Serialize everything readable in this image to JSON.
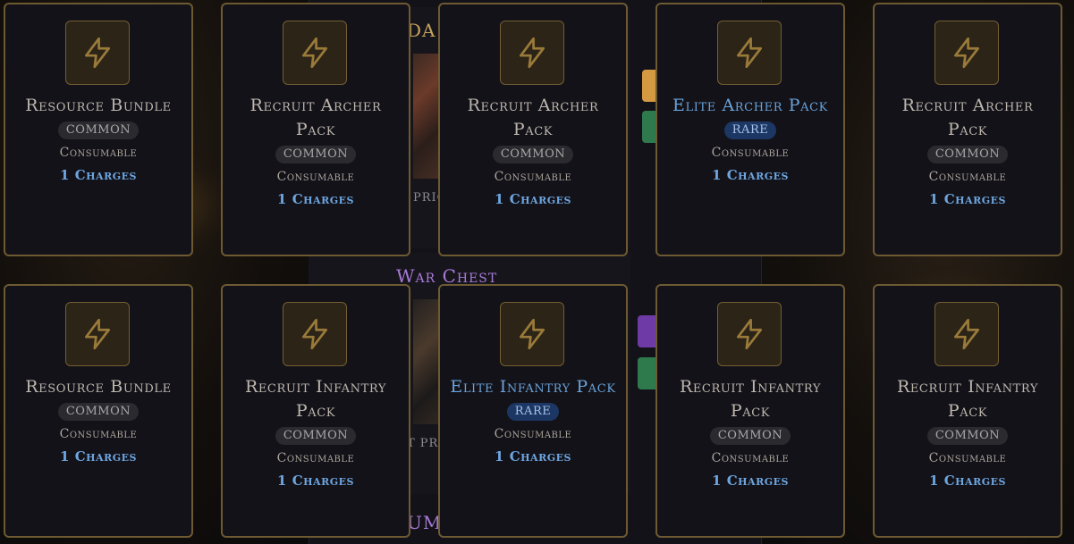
{
  "background_sections": [
    {
      "title": "DA",
      "subtitle": "PRIC",
      "title_color": "#c6a35c"
    },
    {
      "title": "War Chest",
      "subtitle": "T PRI",
      "title_color": "#a77ad8"
    },
    {
      "title": "UMA",
      "subtitle": "",
      "title_color": "#a77ad8"
    }
  ],
  "side_button_colors": [
    "#d49a42",
    "#2f7a4d",
    "#6e3aa6",
    "#2f7a4d"
  ],
  "icon_name": "lightning-bolt-icon",
  "colors": {
    "card_border": "#6d5a32",
    "icon_stroke": "#9a7a3a",
    "rare_name": "#6aa2d9",
    "charges": "#6ea6e0"
  },
  "cards": [
    {
      "name": "Resource Bundle",
      "rarity": "common",
      "rarity_label": "COMMON",
      "type": "Consumable",
      "charges": "1 Charges"
    },
    {
      "name": "Recruit Archer Pack",
      "rarity": "common",
      "rarity_label": "COMMON",
      "type": "Consumable",
      "charges": "1 Charges"
    },
    {
      "name": "Recruit Archer Pack",
      "rarity": "common",
      "rarity_label": "COMMON",
      "type": "Consumable",
      "charges": "1 Charges"
    },
    {
      "name": "Elite Archer Pack",
      "rarity": "rare",
      "rarity_label": "RARE",
      "type": "Consumable",
      "charges": "1 Charges"
    },
    {
      "name": "Recruit Archer Pack",
      "rarity": "common",
      "rarity_label": "COMMON",
      "type": "Consumable",
      "charges": "1 Charges"
    },
    {
      "name": "Resource Bundle",
      "rarity": "common",
      "rarity_label": "COMMON",
      "type": "Consumable",
      "charges": "1 Charges"
    },
    {
      "name": "Recruit Infantry Pack",
      "rarity": "common",
      "rarity_label": "COMMON",
      "type": "Consumable",
      "charges": "1 Charges"
    },
    {
      "name": "Elite Infantry Pack",
      "rarity": "rare",
      "rarity_label": "RARE",
      "type": "Consumable",
      "charges": "1 Charges"
    },
    {
      "name": "Recruit Infantry Pack",
      "rarity": "common",
      "rarity_label": "COMMON",
      "type": "Consumable",
      "charges": "1 Charges"
    },
    {
      "name": "Recruit Infantry Pack",
      "rarity": "common",
      "rarity_label": "COMMON",
      "type": "Consumable",
      "charges": "1 Charges"
    }
  ]
}
